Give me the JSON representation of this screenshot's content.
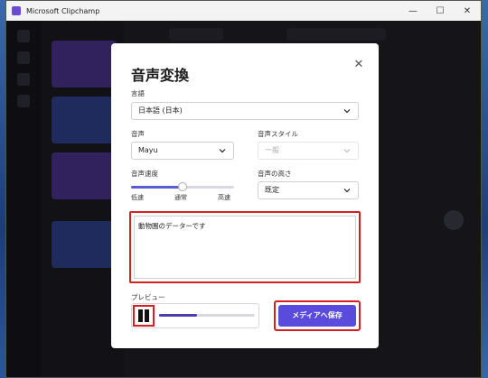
{
  "window": {
    "title": "Microsoft Clipchamp",
    "controls": {
      "minimize": "—",
      "maximize": "☐",
      "close": "✕"
    }
  },
  "dialog": {
    "title": "音声変換",
    "close_icon": "✕",
    "language": {
      "label": "言語",
      "value": "日本語 (日本)"
    },
    "voice": {
      "label": "音声",
      "value": "Mayu"
    },
    "style": {
      "label": "音声スタイル",
      "value": "一般"
    },
    "speed": {
      "label": "音声速度",
      "ticks": [
        "低速",
        "通常",
        "高速"
      ],
      "value_fraction": 0.5
    },
    "pitch": {
      "label": "音声の高さ",
      "value": "既定"
    },
    "text": "動物園のデーターです",
    "preview": {
      "label": "プレビュー",
      "progress_fraction": 0.4,
      "state": "playing"
    },
    "save_button": "メディアへ保存"
  },
  "colors": {
    "accent": "#5b4bdc",
    "highlight": "#d42020"
  }
}
